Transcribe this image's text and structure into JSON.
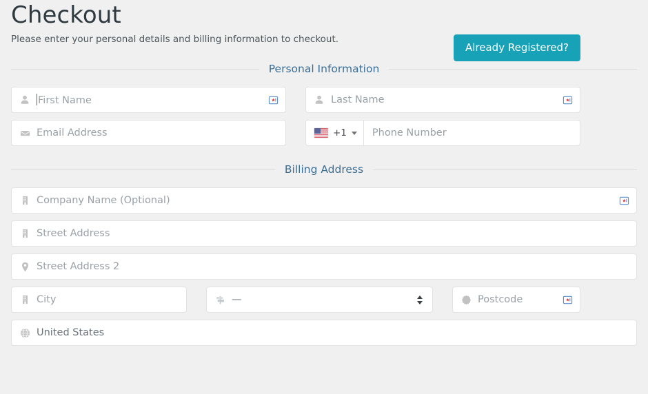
{
  "header": {
    "title": "Checkout",
    "subtitle": "Please enter your personal details and billing information to checkout.",
    "registered_button": "Already Registered?",
    "accent_color": "#17a2b8"
  },
  "sections": {
    "personal": {
      "title": "Personal Information",
      "title_color": "#3b6e96"
    },
    "billing": {
      "title": "Billing Address",
      "title_color": "#3b6e96"
    }
  },
  "fields": {
    "first_name": {
      "placeholder": "First Name",
      "value": "",
      "icon": "user-icon",
      "badge": "autofill-badge-icon",
      "focused": true
    },
    "last_name": {
      "placeholder": "Last Name",
      "value": "",
      "icon": "user-icon",
      "badge": "autofill-badge-icon"
    },
    "email": {
      "placeholder": "Email Address",
      "value": "",
      "icon": "envelope-icon"
    },
    "phone": {
      "placeholder": "Phone Number",
      "value": "",
      "country_flag": "united-states-flag-icon",
      "dial_code": "+1",
      "dropdown_icon": "chevron-down-icon"
    },
    "company": {
      "placeholder": "Company Name (Optional)",
      "value": "",
      "icon": "building-icon",
      "badge": "autofill-badge-icon"
    },
    "street_address": {
      "placeholder": "Street Address",
      "value": "",
      "icon": "building-icon"
    },
    "street_address_2": {
      "placeholder": "Street Address 2",
      "value": "",
      "icon": "map-pin-icon"
    },
    "city": {
      "placeholder": "City",
      "value": "",
      "icon": "building-icon"
    },
    "state": {
      "selected": "—",
      "icon": "signpost-icon",
      "spinner_icon": "updown-arrows-icon"
    },
    "postcode": {
      "placeholder": "Postcode",
      "value": "",
      "icon": "certificate-icon",
      "badge": "autofill-badge-icon"
    },
    "country": {
      "value": "United States",
      "icon": "globe-icon"
    }
  }
}
